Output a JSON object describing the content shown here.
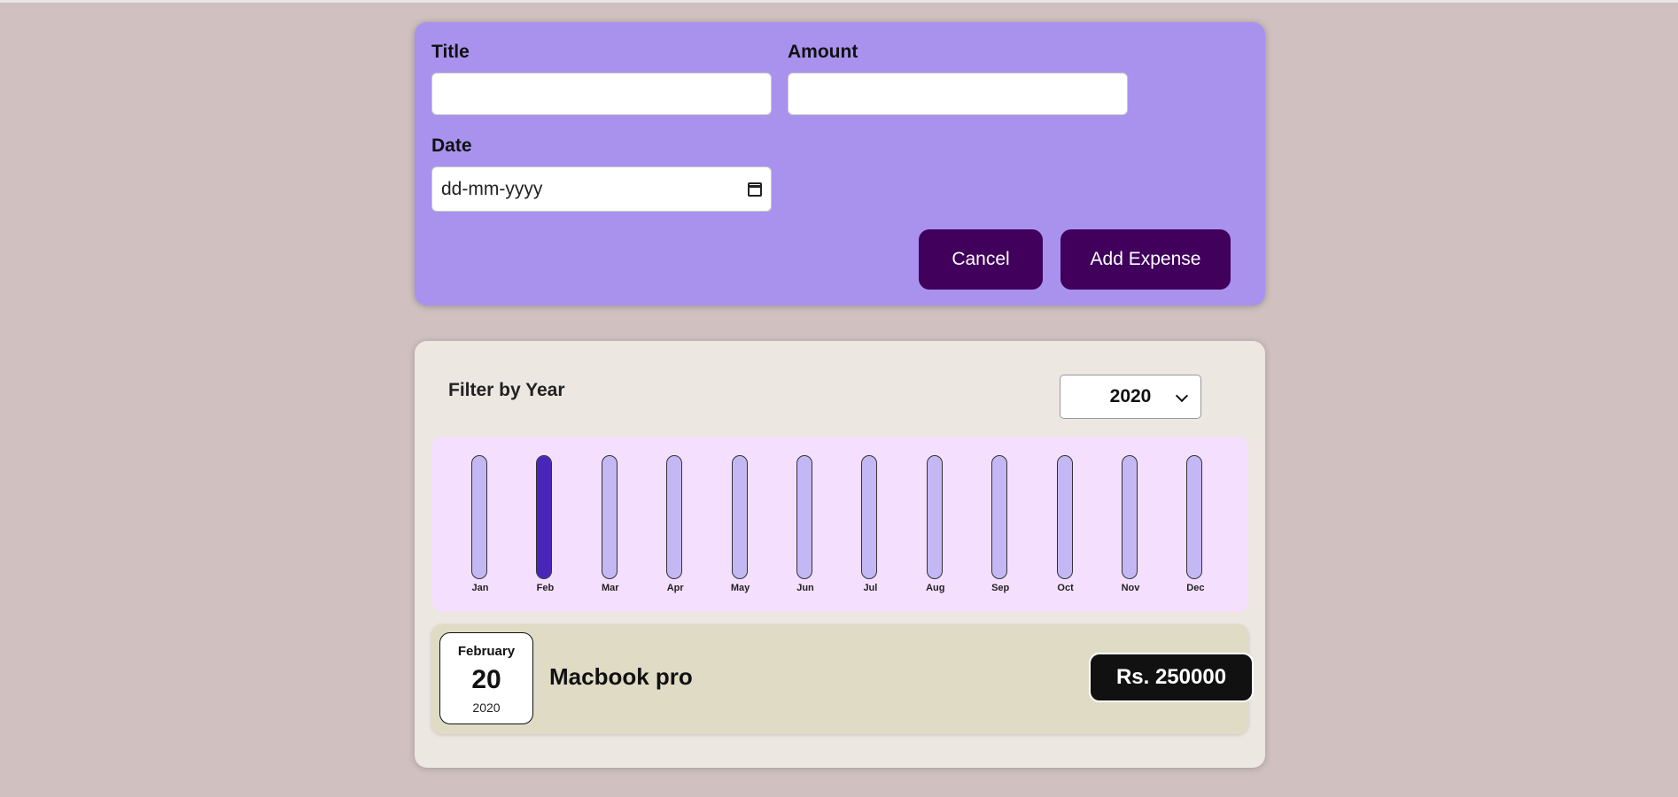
{
  "form": {
    "title_label": "Title",
    "title_value": "",
    "amount_label": "Amount",
    "amount_value": "",
    "date_label": "Date",
    "date_placeholder": "dd-mm-yyyy",
    "cancel_label": "Cancel",
    "add_label": "Add Expense",
    "colors": {
      "card": "#a892ee",
      "button": "#40005c"
    }
  },
  "filter": {
    "label": "Filter by Year",
    "selected_year": "2020"
  },
  "chart_data": {
    "type": "bar",
    "categories": [
      "Jan",
      "Feb",
      "Mar",
      "Apr",
      "May",
      "Jun",
      "Jul",
      "Aug",
      "Sep",
      "Oct",
      "Nov",
      "Dec"
    ],
    "values": [
      0,
      250000,
      0,
      0,
      0,
      0,
      0,
      0,
      0,
      0,
      0,
      0
    ],
    "ylim": [
      0,
      250000
    ],
    "colors": {
      "track": "#c3b8f3",
      "fill": "#4826b9",
      "background": "#f5dfff"
    }
  },
  "expenses": [
    {
      "month": "February",
      "day": "20",
      "year": "2020",
      "title": "Macbook pro",
      "amount": "Rs. 250000"
    }
  ]
}
